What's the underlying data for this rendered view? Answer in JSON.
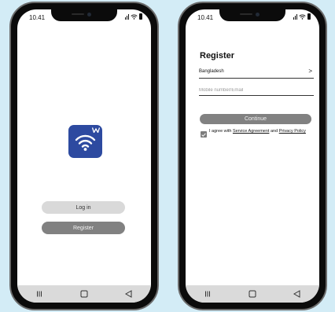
{
  "home": {
    "time": "10.41",
    "login_label": "Log in",
    "register_label": "Register"
  },
  "register": {
    "time": "10.41",
    "title": "Register",
    "country": "Bangladesh",
    "country_arrow": ">",
    "mobile_placeholder": "Mobile number/Email",
    "continue_label": "Continue",
    "agree_prefix": "I agree with",
    "service_link": "Service Agreement",
    "and_text": "and",
    "privacy_link": "Privacy Policy"
  },
  "icons": {
    "app_logo": "wifi-icon",
    "logo_mark": "w-letter-mark",
    "status": [
      "signal-icon",
      "wifi-icon",
      "battery-icon"
    ],
    "nav": [
      "recent-apps-icon",
      "home-icon",
      "back-icon"
    ]
  },
  "colors": {
    "background": "#d3ecf6",
    "app_logo": "#2d4aa0",
    "primary_button": "#818181",
    "secondary_button": "#d9d9d9"
  }
}
